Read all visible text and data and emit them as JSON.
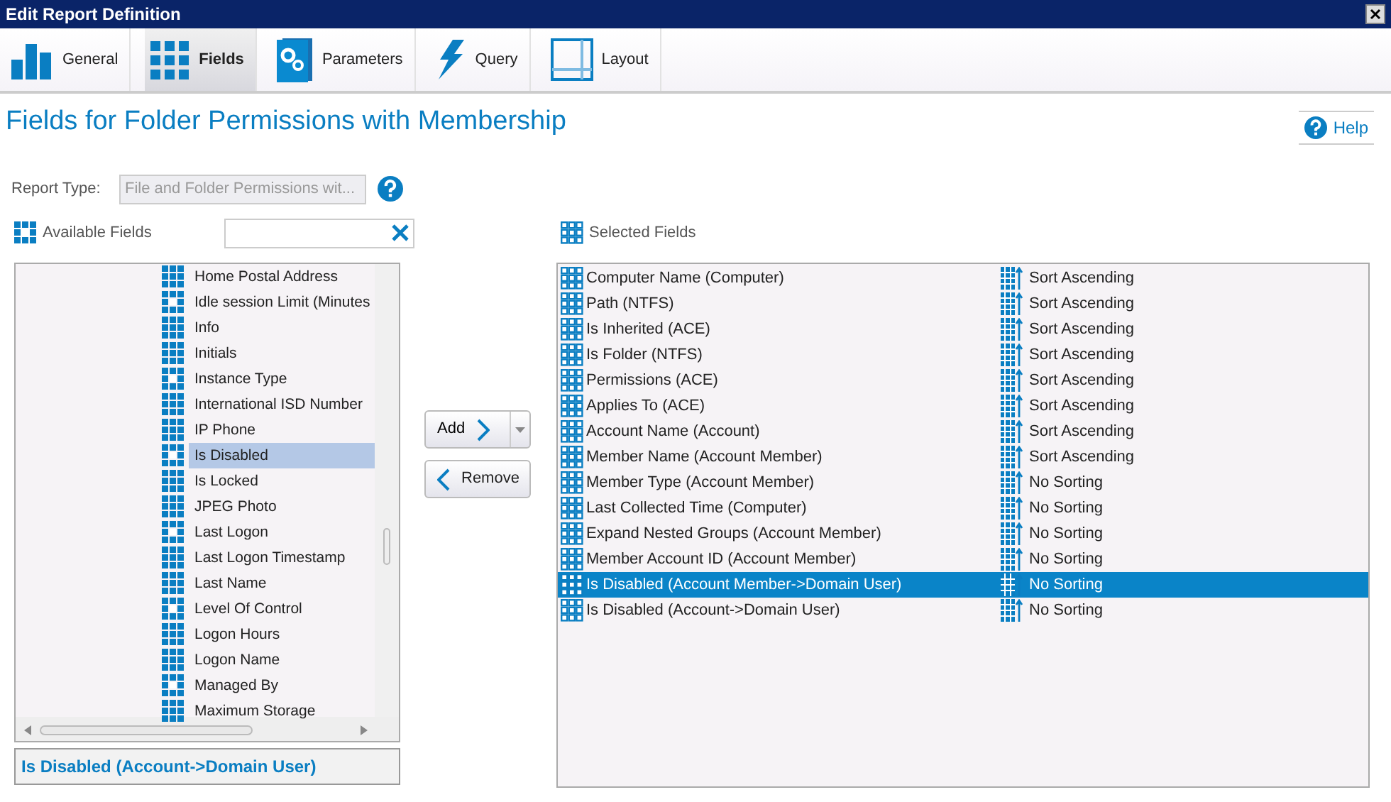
{
  "window": {
    "title": "Edit Report Definition"
  },
  "tabs": [
    {
      "label": "General",
      "selected": false
    },
    {
      "label": "Fields",
      "selected": true
    },
    {
      "label": "Parameters",
      "selected": false
    },
    {
      "label": "Query",
      "selected": false
    },
    {
      "label": "Layout",
      "selected": false
    }
  ],
  "heading": "Fields for Folder Permissions with Membership",
  "help": "Help",
  "report_type": {
    "label": "Report Type:",
    "value": "File and Folder Permissions wit..."
  },
  "available_fields": {
    "label": "Available Fields",
    "items": [
      {
        "name": "Home Postal Address",
        "selected": false
      },
      {
        "name": "Idle session Limit (Minutes",
        "selected": false
      },
      {
        "name": "Info",
        "selected": false
      },
      {
        "name": "Initials",
        "selected": false
      },
      {
        "name": "Instance Type",
        "selected": false
      },
      {
        "name": "International ISD Number",
        "selected": false
      },
      {
        "name": "IP Phone",
        "selected": false
      },
      {
        "name": "Is Disabled",
        "selected": true
      },
      {
        "name": "Is Locked",
        "selected": false
      },
      {
        "name": "JPEG Photo",
        "selected": false
      },
      {
        "name": "Last Logon",
        "selected": false
      },
      {
        "name": "Last Logon Timestamp",
        "selected": false
      },
      {
        "name": "Last Name",
        "selected": false
      },
      {
        "name": "Level Of Control",
        "selected": false
      },
      {
        "name": "Logon Hours",
        "selected": false
      },
      {
        "name": "Logon Name",
        "selected": false
      },
      {
        "name": "Managed By",
        "selected": false
      },
      {
        "name": "Maximum Storage",
        "selected": false
      }
    ]
  },
  "buttons": {
    "add": "Add",
    "remove": "Remove"
  },
  "selected_fields": {
    "label": "Selected Fields",
    "items": [
      {
        "name": "Computer Name (Computer)",
        "sort": "Sort Ascending",
        "selected": false
      },
      {
        "name": "Path (NTFS)",
        "sort": "Sort Ascending",
        "selected": false
      },
      {
        "name": "Is Inherited (ACE)",
        "sort": "Sort Ascending",
        "selected": false
      },
      {
        "name": "Is Folder (NTFS)",
        "sort": "Sort Ascending",
        "selected": false
      },
      {
        "name": "Permissions (ACE)",
        "sort": "Sort Ascending",
        "selected": false
      },
      {
        "name": "Applies To (ACE)",
        "sort": "Sort Ascending",
        "selected": false
      },
      {
        "name": "Account Name (Account)",
        "sort": "Sort Ascending",
        "selected": false
      },
      {
        "name": "Member Name (Account Member)",
        "sort": "Sort Ascending",
        "selected": false
      },
      {
        "name": "Member Type (Account Member)",
        "sort": "No Sorting",
        "selected": false
      },
      {
        "name": "Last Collected Time (Computer)",
        "sort": "No Sorting",
        "selected": false
      },
      {
        "name": "Expand Nested Groups (Account Member)",
        "sort": "No Sorting",
        "selected": false
      },
      {
        "name": "Member Account ID (Account Member)",
        "sort": "No Sorting",
        "selected": false
      },
      {
        "name": "Is Disabled (Account Member->Domain User)",
        "sort": "No Sorting",
        "selected": true
      },
      {
        "name": "Is Disabled (Account->Domain User)",
        "sort": "No Sorting",
        "selected": false
      }
    ]
  },
  "description": {
    "title": "Is Disabled (Account->Domain User)"
  }
}
